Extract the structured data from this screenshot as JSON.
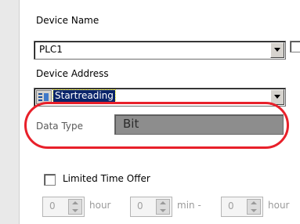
{
  "device_name": {
    "label": "Device Name",
    "value": "PLC1"
  },
  "device_address": {
    "label": "Device Address",
    "value": "Startreading"
  },
  "data_type": {
    "label": "Data Type",
    "value": "Bit"
  },
  "limited_time": {
    "label": "Limited Time Offer",
    "checked": false,
    "hour_value": "0",
    "hour_unit": "hour",
    "min_value": "0",
    "min_unit": "min -",
    "hour2_value": "0",
    "hour2_unit": "hour"
  },
  "colors": {
    "highlight": "#e8202a",
    "selection": "#0a246a"
  }
}
